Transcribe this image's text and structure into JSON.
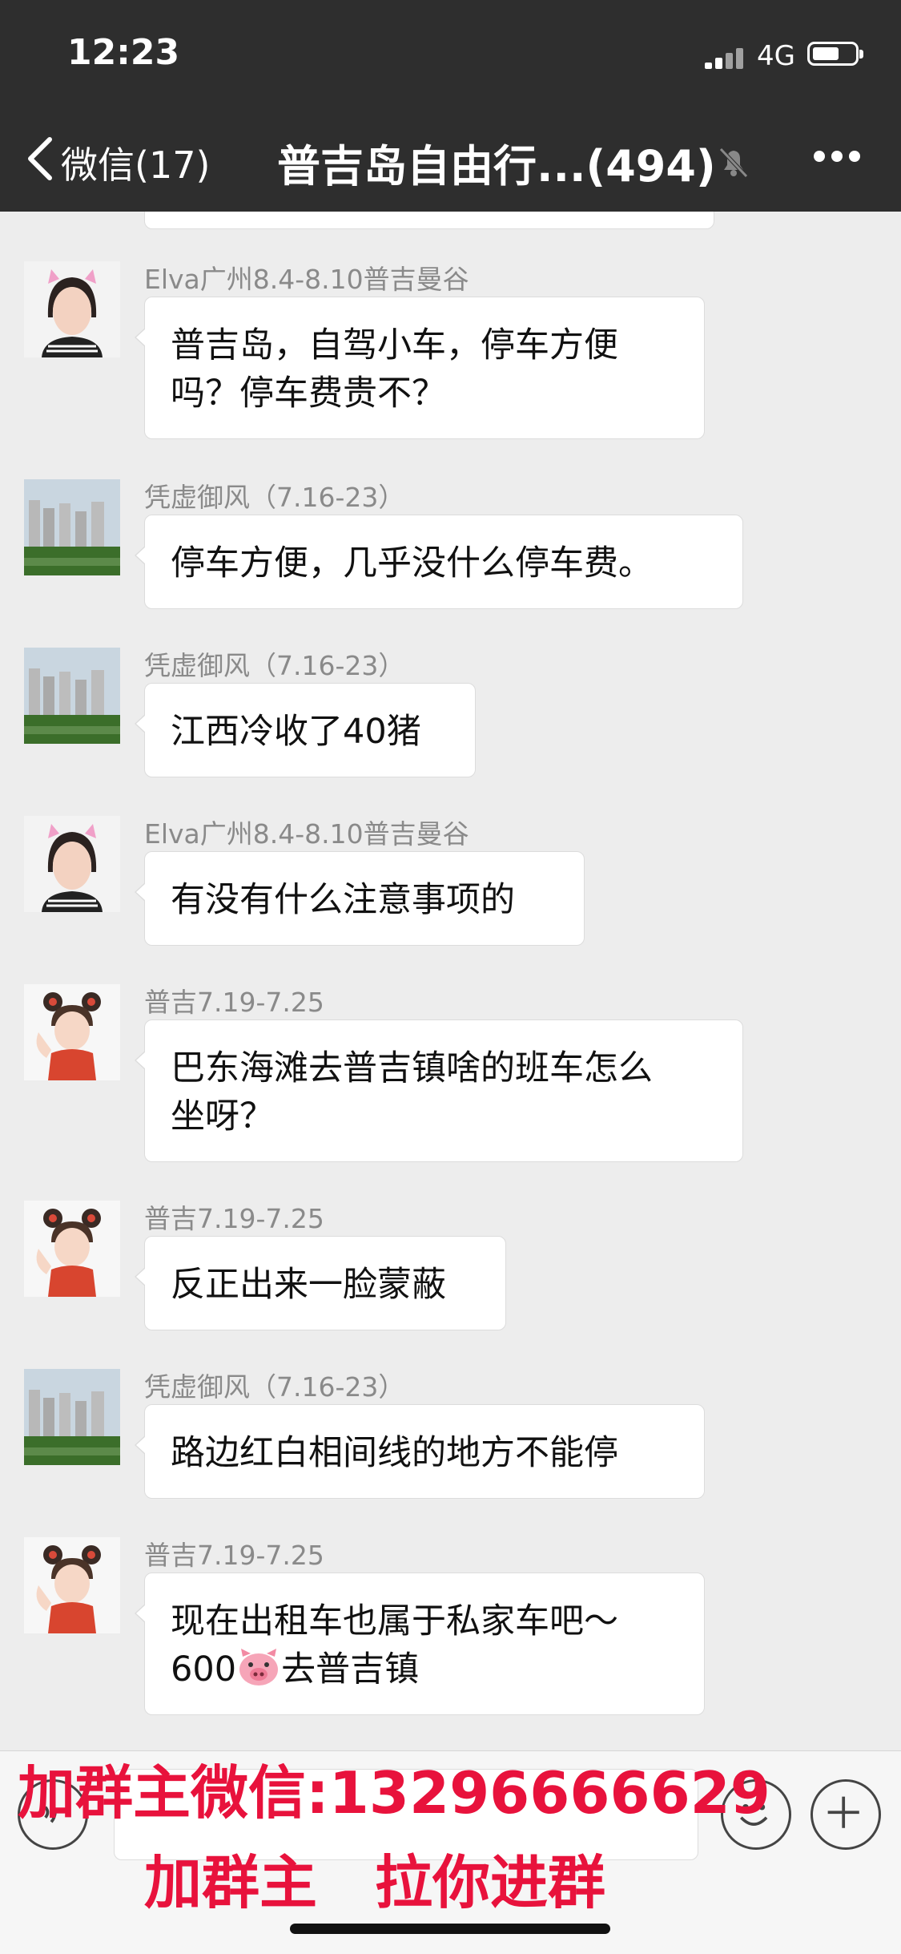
{
  "status_bar": {
    "time": "12:23",
    "network": "4G"
  },
  "header": {
    "back_label": "微信(17)",
    "title": "普吉岛自由行...(494)",
    "icons": [
      "back-chevron-icon",
      "mute-bell-icon",
      "more-icon"
    ]
  },
  "messages": [
    {
      "sender": "Elva广州8.4-8.10普吉曼谷",
      "avatar": "avatar-woman-cat-ears",
      "text": "普吉岛，自驾小车，停车方便\n吗？停车费贵不？"
    },
    {
      "sender": "凭虚御风（7.16-23）",
      "avatar": "avatar-city-buildings",
      "text": "停车方便，几乎没什么停车费。"
    },
    {
      "sender": "凭虚御风（7.16-23）",
      "avatar": "avatar-city-buildings",
      "text": "江西冷收了40猪"
    },
    {
      "sender": "Elva广州8.4-8.10普吉曼谷",
      "avatar": "avatar-woman-cat-ears",
      "text": "有没有什么注意事项的"
    },
    {
      "sender": "普吉7.19-7.25",
      "avatar": "avatar-child-bear-ears",
      "text": "巴东海滩去普吉镇啥的班车怎么\n坐呀？"
    },
    {
      "sender": "普吉7.19-7.25",
      "avatar": "avatar-child-bear-ears",
      "text": "反正出来一脸蒙蔽"
    },
    {
      "sender": "凭虚御风（7.16-23）",
      "avatar": "avatar-city-buildings",
      "text": "路边红白相间线的地方不能停"
    },
    {
      "sender": "普吉7.19-7.25",
      "avatar": "avatar-child-bear-ears",
      "text_line1": "现在出租车也属于私家车吧～",
      "text_line2_pre": "600",
      "text_line2_post": "去普吉镇"
    }
  ],
  "input_bar": {
    "icons": [
      "voice-icon",
      "emoji-icon",
      "plus-icon"
    ]
  },
  "overlay": {
    "line1": "加群主微信:13296666629",
    "line2": "加群主　拉你进群",
    "color": "#e8123c"
  }
}
